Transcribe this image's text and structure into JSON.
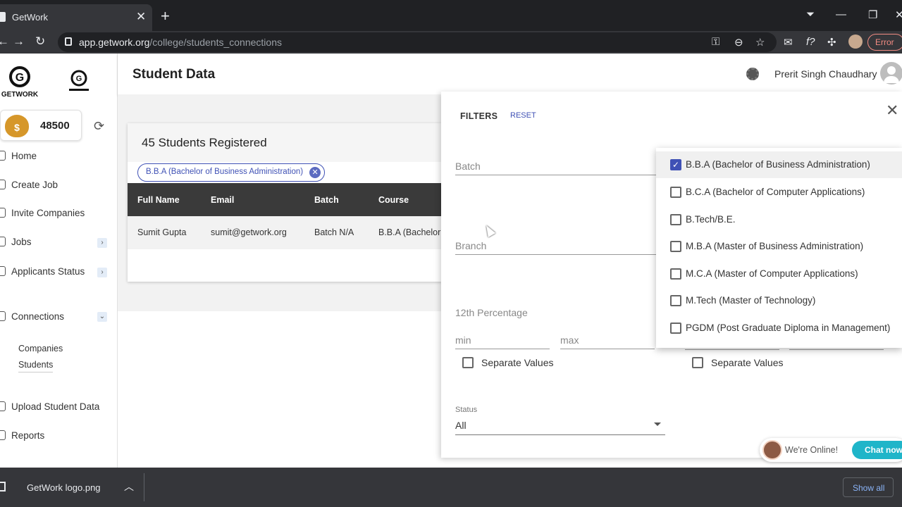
{
  "browser": {
    "tab_title": "GetWork",
    "tab_close": "✕",
    "new_tab": "+",
    "url_domain": "app.getwork.org",
    "url_path": "/college/students_connections",
    "error_label": "Error"
  },
  "sidebar": {
    "credits": "48500",
    "items": [
      {
        "label": "Home"
      },
      {
        "label": "Create Job"
      },
      {
        "label": "Invite Companies"
      },
      {
        "label": "Jobs"
      },
      {
        "label": "Applicants Status"
      },
      {
        "label": "Connections"
      },
      {
        "label": "Upload Student Data"
      },
      {
        "label": "Reports"
      }
    ],
    "subitems": [
      {
        "label": "Companies"
      },
      {
        "label": "Students"
      }
    ]
  },
  "header": {
    "title": "Student Data",
    "user_name": "Prerit Singh Chaudhary"
  },
  "card": {
    "title": "45 Students Registered",
    "chip": "B.B.A (Bachelor of Business Administration)",
    "columns": [
      "Full Name",
      "Email",
      "Batch",
      "Course"
    ],
    "rows": [
      [
        "Sumit Gupta",
        "sumit@getwork.org",
        "Batch N/A",
        "B.B.A (Bachelor"
      ]
    ]
  },
  "filters": {
    "title": "FILTERS",
    "reset": "RESET",
    "batch_label": "Batch",
    "branch_label": "Branch",
    "percentage_label": "12th Percentage",
    "min_placeholder": "min",
    "max_placeholder": "max",
    "separate_values": "Separate Values",
    "status_label": "Status",
    "status_value": "All",
    "course_options": [
      {
        "label": "B.B.A (Bachelor of Business Administration)",
        "checked": true
      },
      {
        "label": "B.C.A (Bachelor of Computer Applications)",
        "checked": false
      },
      {
        "label": "B.Tech/B.E.",
        "checked": false
      },
      {
        "label": "M.B.A (Master of Business Administration)",
        "checked": false
      },
      {
        "label": "M.C.A (Master of Computer Applications)",
        "checked": false
      },
      {
        "label": "M.Tech (Master of Technology)",
        "checked": false
      },
      {
        "label": "PGDM (Post Graduate Diploma in Management)",
        "checked": false
      }
    ]
  },
  "chat": {
    "status": "We're Online!",
    "button": "Chat now"
  },
  "downloads": {
    "file_name": "GetWork logo.png",
    "show_all": "Show all"
  },
  "colors": {
    "accent": "#3f51b5",
    "chat_button": "#1fb5c9",
    "table_header": "#3a3a3a"
  }
}
